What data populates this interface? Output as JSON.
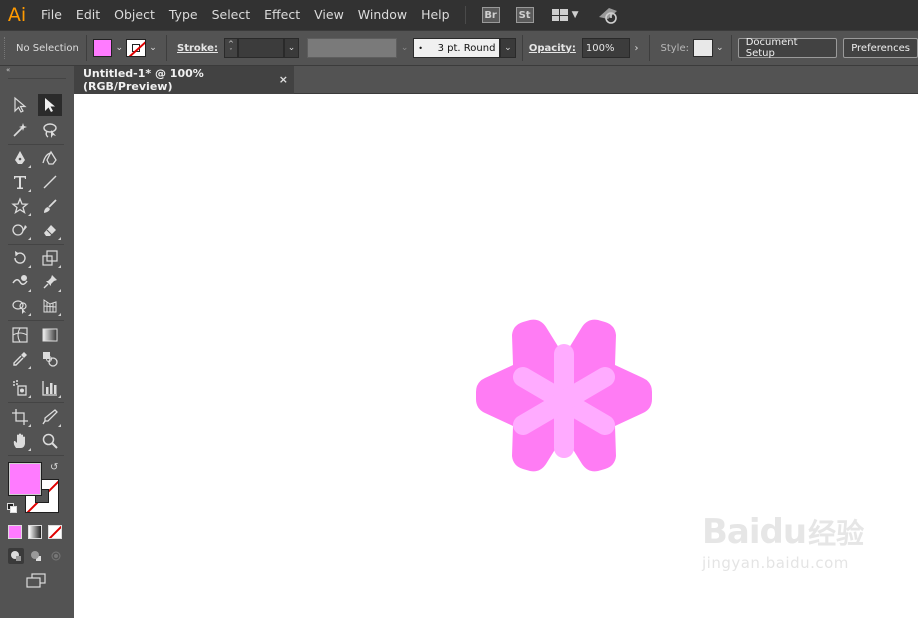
{
  "app": {
    "logo": "Ai",
    "menu": [
      "File",
      "Edit",
      "Object",
      "Type",
      "Select",
      "Effect",
      "View",
      "Window",
      "Help"
    ],
    "bridge_label": "Br",
    "stock_label": "St"
  },
  "control_bar": {
    "selection_status": "No Selection",
    "stroke_label": "Stroke:",
    "brush_value": "3 pt. Round",
    "opacity_label": "Opacity:",
    "opacity_value": "100%",
    "style_label": "Style:",
    "document_setup_label": "Document Setup",
    "preferences_label": "Preferences"
  },
  "document": {
    "tab_title": "Untitled-1* @ 100% (RGB/Preview)",
    "close_glyph": "×"
  },
  "colors": {
    "fill": "#ff7bff",
    "star_fill": "#ff7cf4",
    "asterisk_fill": "#ffabff",
    "stroke_none_line": "#e00000"
  },
  "watermark": {
    "logo_text": "Baidu",
    "logo_cn": "经验",
    "url": "jingyan.baidu.com"
  }
}
